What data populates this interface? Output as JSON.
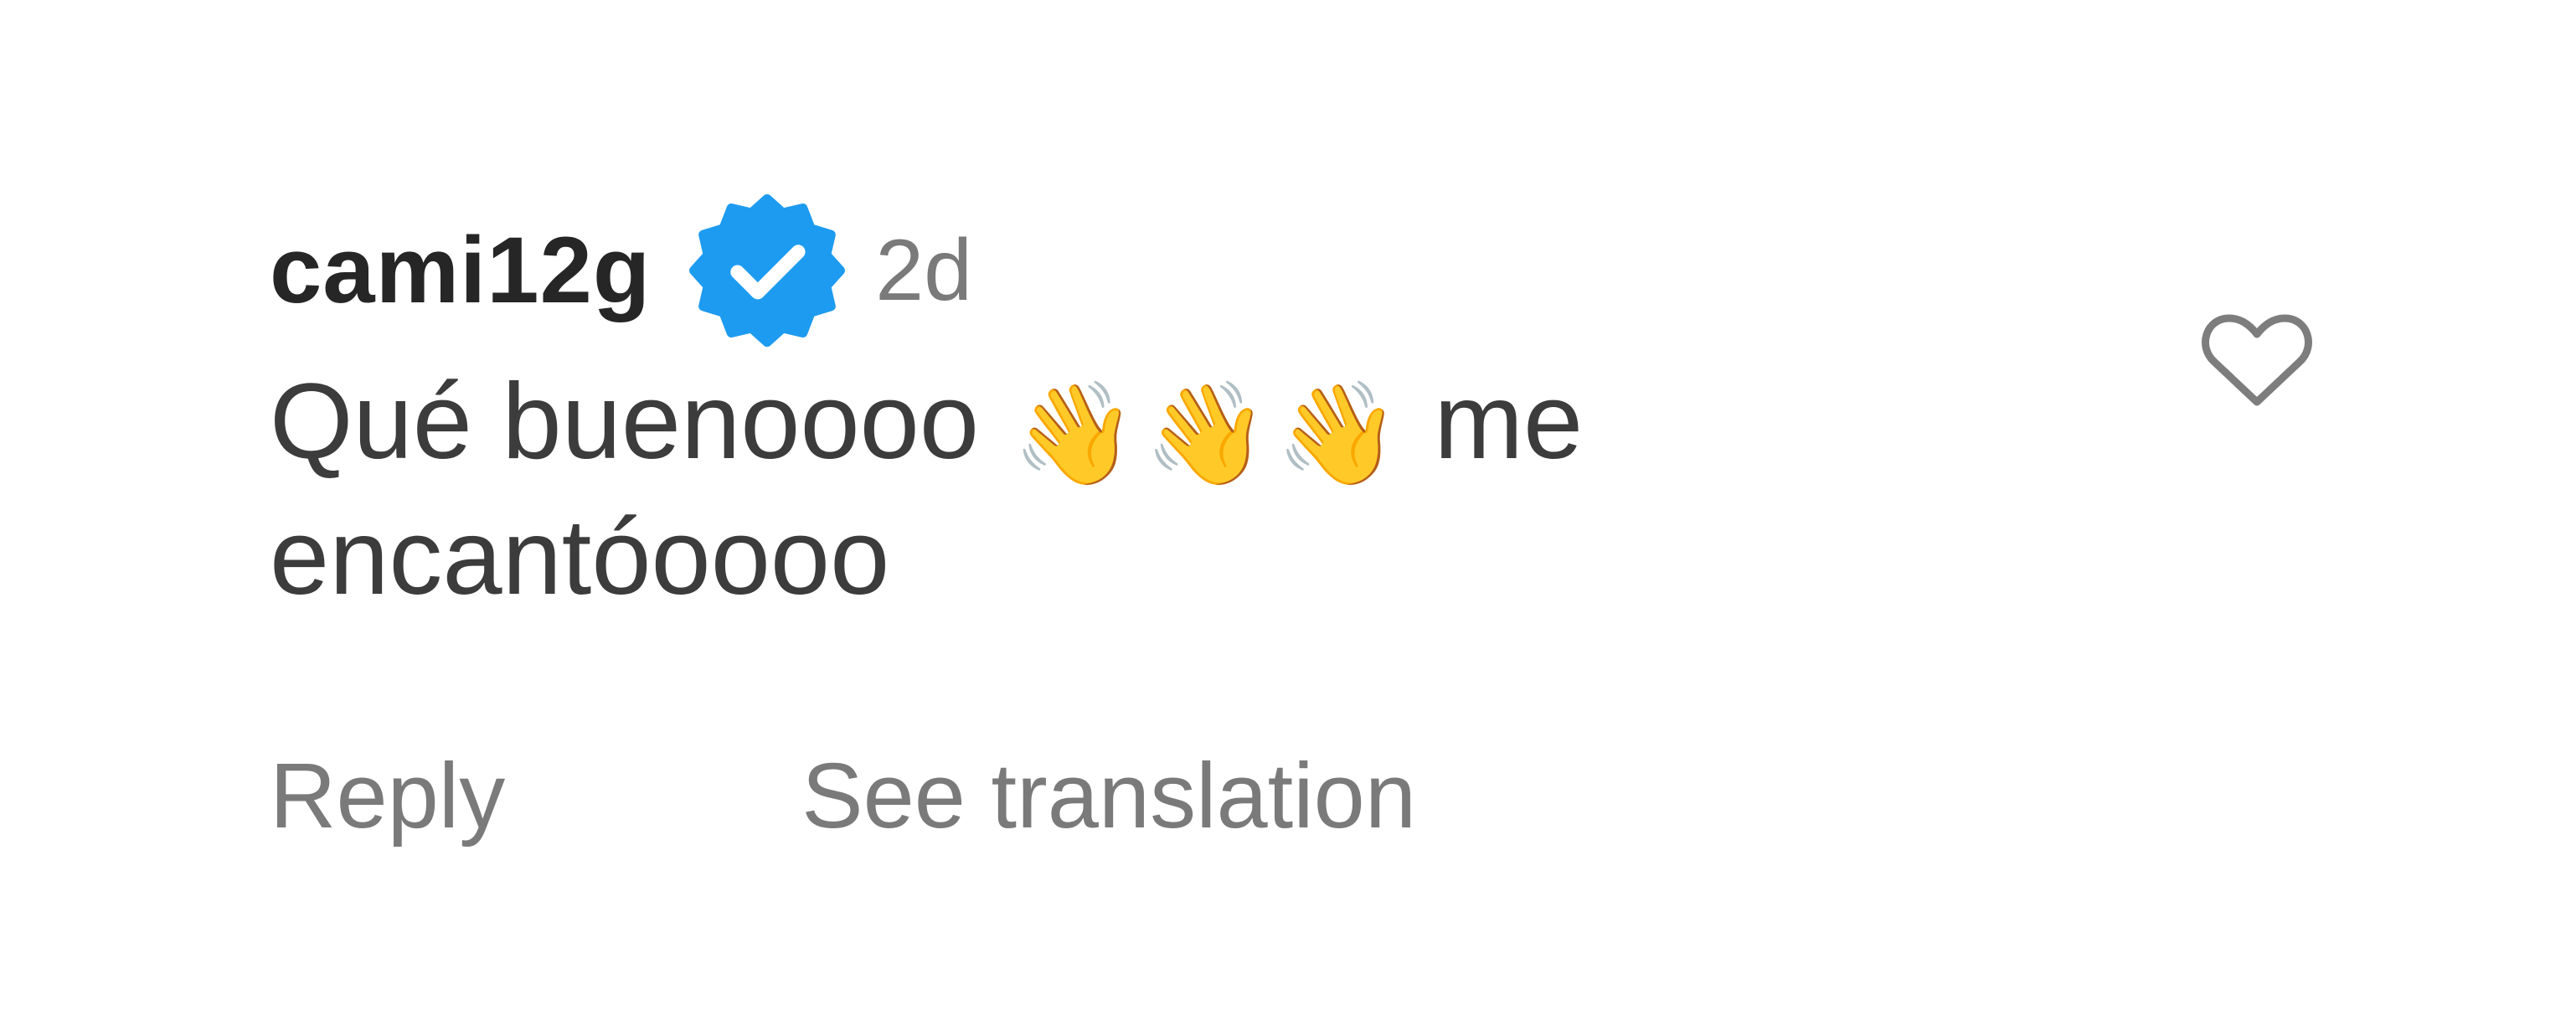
{
  "comment": {
    "username": "cami12g",
    "verified": true,
    "timestamp": "2d",
    "text_before": "Qué buenoooo",
    "emoji": "👋",
    "text_after": "me encantóoooo",
    "liked": false
  },
  "actions": {
    "reply_label": "Reply",
    "translate_label": "See translation"
  },
  "icons": {
    "verified": "verified-badge-icon",
    "like": "heart-outline-icon",
    "emoji": "waving-hand-emoji"
  },
  "colors": {
    "verified_badge": "#1d9bf0",
    "username": "#262626",
    "secondary": "#7a7a7a",
    "body": "#3c3c3c"
  }
}
